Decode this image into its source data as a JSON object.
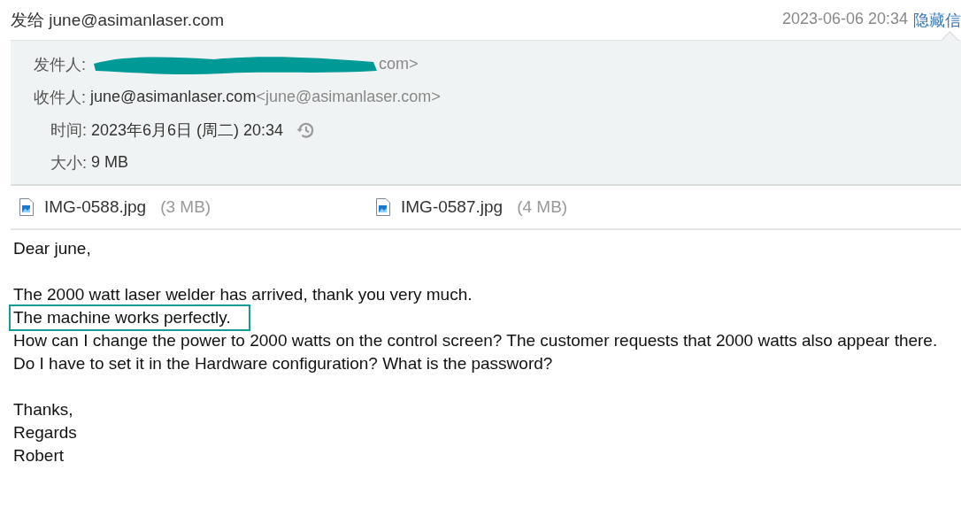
{
  "header": {
    "subject": "发给 june@asimanlaser.com",
    "date": "2023-06-06 20:34",
    "hide_link": "隐藏信"
  },
  "details": [
    {
      "kind": "sender",
      "label": "发件人:",
      "redacted": true,
      "value": "com>"
    },
    {
      "kind": "recipient",
      "label": "收件人:",
      "name": "june@asimanlaser.com",
      "address": "<june@asimanlaser.com>"
    },
    {
      "kind": "time",
      "label": "时间:",
      "value": "2023年6月6日 (周二) 20:34"
    },
    {
      "kind": "size",
      "label": "大小:",
      "value": "9 MB"
    }
  ],
  "attachments": [
    {
      "name": "IMG-0588.jpg",
      "size": "(3 MB)"
    },
    {
      "name": "IMG-0587.jpg",
      "size": "(4 MB)"
    }
  ],
  "body": [
    {
      "kind": "paragraph",
      "lines": [
        {
          "text": "Dear june,",
          "highlighted": false
        }
      ]
    },
    {
      "kind": "paragraph",
      "lines": [
        {
          "text": "The 2000 watt laser welder has arrived, thank you very much.",
          "highlighted": false
        },
        {
          "text": "The machine works perfectly.",
          "highlighted": true
        },
        {
          "text": "How can I change the power to 2000 watts on the control screen? The customer requests that 2000 watts also appear there.",
          "highlighted": false
        },
        {
          "text": "Do I have to set it in the Hardware configuration? What is the password?",
          "highlighted": false
        }
      ]
    },
    {
      "kind": "signature",
      "lines": [
        {
          "text": "Thanks,",
          "highlighted": false
        },
        {
          "text": "Regards",
          "highlighted": false
        },
        {
          "text": "Robert",
          "highlighted": false
        }
      ]
    }
  ]
}
